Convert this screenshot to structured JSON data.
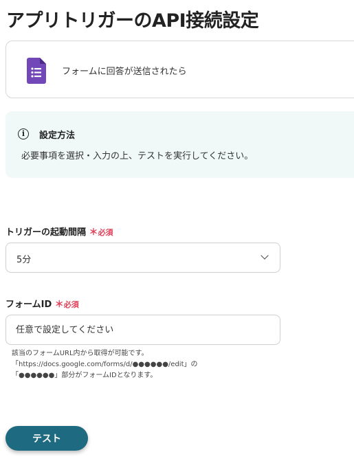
{
  "page": {
    "title": "アプリトリガーのAPI接続設定"
  },
  "app_card": {
    "icon": "google-forms-icon",
    "trigger_label": "フォームに回答が送信されたら",
    "icon_color": "#7248b9"
  },
  "info_box": {
    "icon": "info-icon",
    "title": "設定方法",
    "text": "必要事項を選択・入力の上、テストを実行してください。",
    "background": "#f0f8f8"
  },
  "interval_field": {
    "label": "トリガーの起動間隔",
    "required_mark": "＊",
    "required_text": "必須",
    "value": "5分"
  },
  "form_id_field": {
    "label": "フォームID",
    "required_mark": "＊",
    "required_text": "必須",
    "placeholder": "任意で設定してください",
    "help_lines": [
      "該当のフォームURL内から取得が可能です。",
      "「https://docs.google.com/forms/d/●●●●●●/edit」の",
      "「●●●●●●」部分がフォームIDとなります。"
    ]
  },
  "actions": {
    "test_label": "テスト",
    "test_color": "#1e6a80"
  }
}
